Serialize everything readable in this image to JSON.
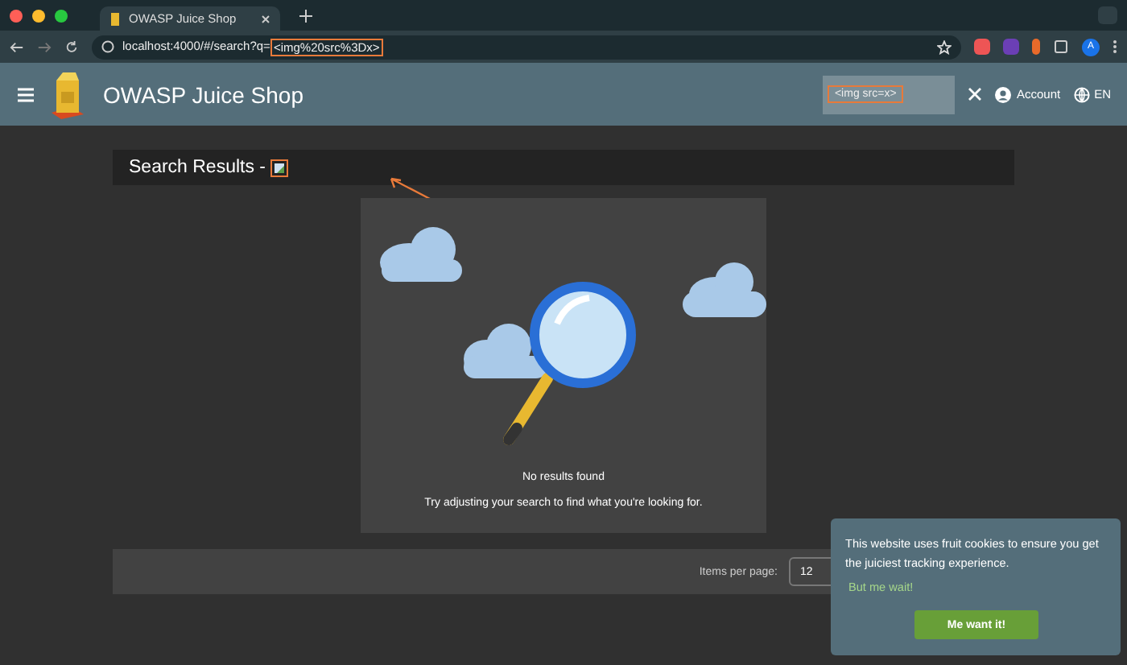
{
  "browser": {
    "tab_title": "OWASP Juice Shop",
    "url_base": "localhost:4000/#/search?q=",
    "url_query": "<img%20src%3Dx>",
    "profile_initial": "A"
  },
  "toolbar": {
    "title": "OWASP Juice Shop",
    "search_value": "<img src=x>",
    "account": "Account",
    "language": "EN"
  },
  "results": {
    "title": "Search Results -",
    "empty_title": "No results found",
    "empty_hint": "Try adjusting your search to find what you're looking for."
  },
  "paginator": {
    "label": "Items per page:",
    "value": "12"
  },
  "cookie_banner": {
    "message": "This website uses fruit cookies to ensure you get the juiciest tracking experience.",
    "link": "But me wait!",
    "button": "Me want it!"
  }
}
